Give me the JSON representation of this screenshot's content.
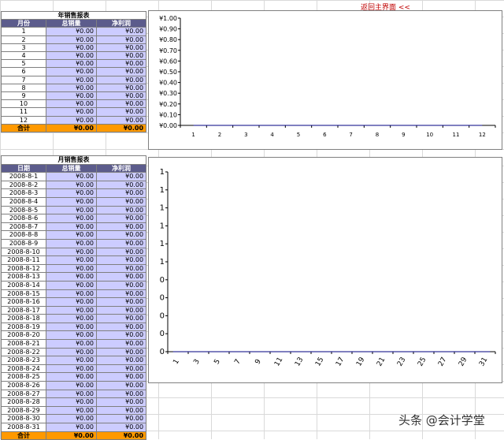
{
  "nav": {
    "return_link": "返回主界面 <<"
  },
  "year_report": {
    "title": "年销售报表",
    "headers": [
      "月份",
      "总销量",
      "净利润"
    ],
    "rows": [
      [
        "1",
        "¥0.00",
        "¥0.00"
      ],
      [
        "2",
        "¥0.00",
        "¥0.00"
      ],
      [
        "3",
        "¥0.00",
        "¥0.00"
      ],
      [
        "4",
        "¥0.00",
        "¥0.00"
      ],
      [
        "5",
        "¥0.00",
        "¥0.00"
      ],
      [
        "6",
        "¥0.00",
        "¥0.00"
      ],
      [
        "7",
        "¥0.00",
        "¥0.00"
      ],
      [
        "8",
        "¥0.00",
        "¥0.00"
      ],
      [
        "9",
        "¥0.00",
        "¥0.00"
      ],
      [
        "10",
        "¥0.00",
        "¥0.00"
      ],
      [
        "11",
        "¥0.00",
        "¥0.00"
      ],
      [
        "12",
        "¥0.00",
        "¥0.00"
      ]
    ],
    "total": [
      "合计",
      "¥0.00",
      "¥0.00"
    ]
  },
  "month_report": {
    "title": "月销售报表",
    "headers": [
      "日期",
      "总销量",
      "净利润"
    ],
    "rows": [
      [
        "2008-8-1",
        "¥0.00",
        "¥0.00"
      ],
      [
        "2008-8-2",
        "¥0.00",
        "¥0.00"
      ],
      [
        "2008-8-3",
        "¥0.00",
        "¥0.00"
      ],
      [
        "2008-8-4",
        "¥0.00",
        "¥0.00"
      ],
      [
        "2008-8-5",
        "¥0.00",
        "¥0.00"
      ],
      [
        "2008-8-6",
        "¥0.00",
        "¥0.00"
      ],
      [
        "2008-8-7",
        "¥0.00",
        "¥0.00"
      ],
      [
        "2008-8-8",
        "¥0.00",
        "¥0.00"
      ],
      [
        "2008-8-9",
        "¥0.00",
        "¥0.00"
      ],
      [
        "2008-8-10",
        "¥0.00",
        "¥0.00"
      ],
      [
        "2008-8-11",
        "¥0.00",
        "¥0.00"
      ],
      [
        "2008-8-12",
        "¥0.00",
        "¥0.00"
      ],
      [
        "2008-8-13",
        "¥0.00",
        "¥0.00"
      ],
      [
        "2008-8-14",
        "¥0.00",
        "¥0.00"
      ],
      [
        "2008-8-15",
        "¥0.00",
        "¥0.00"
      ],
      [
        "2008-8-16",
        "¥0.00",
        "¥0.00"
      ],
      [
        "2008-8-17",
        "¥0.00",
        "¥0.00"
      ],
      [
        "2008-8-18",
        "¥0.00",
        "¥0.00"
      ],
      [
        "2008-8-19",
        "¥0.00",
        "¥0.00"
      ],
      [
        "2008-8-20",
        "¥0.00",
        "¥0.00"
      ],
      [
        "2008-8-21",
        "¥0.00",
        "¥0.00"
      ],
      [
        "2008-8-22",
        "¥0.00",
        "¥0.00"
      ],
      [
        "2008-8-23",
        "¥0.00",
        "¥0.00"
      ],
      [
        "2008-8-24",
        "¥0.00",
        "¥0.00"
      ],
      [
        "2008-8-25",
        "¥0.00",
        "¥0.00"
      ],
      [
        "2008-8-26",
        "¥0.00",
        "¥0.00"
      ],
      [
        "2008-8-27",
        "¥0.00",
        "¥0.00"
      ],
      [
        "2008-8-28",
        "¥0.00",
        "¥0.00"
      ],
      [
        "2008-8-29",
        "¥0.00",
        "¥0.00"
      ],
      [
        "2008-8-30",
        "¥0.00",
        "¥0.00"
      ],
      [
        "2008-8-31",
        "¥0.00",
        "¥0.00"
      ]
    ],
    "total": [
      "合计",
      "¥0.00",
      "¥0.00"
    ]
  },
  "chart_data": [
    {
      "type": "line",
      "x": [
        "1",
        "2",
        "3",
        "4",
        "5",
        "6",
        "7",
        "8",
        "9",
        "10",
        "11",
        "12"
      ],
      "y_ticks": [
        "¥0.00",
        "¥0.10",
        "¥0.20",
        "¥0.30",
        "¥0.40",
        "¥0.50",
        "¥0.60",
        "¥0.70",
        "¥0.80",
        "¥0.90",
        "¥1.00"
      ],
      "ylim": [
        0,
        1
      ],
      "values": [
        0,
        0,
        0,
        0,
        0,
        0,
        0,
        0,
        0,
        0,
        0,
        0
      ],
      "grid": false
    },
    {
      "type": "line",
      "x": [
        "1",
        "3",
        "5",
        "7",
        "9",
        "11",
        "13",
        "15",
        "17",
        "19",
        "21",
        "23",
        "25",
        "27",
        "29",
        "31"
      ],
      "y_ticks": [
        "0",
        "0",
        "0",
        "0",
        "0",
        "1",
        "1",
        "1",
        "1",
        "1",
        "1"
      ],
      "ylim": [
        0,
        1
      ],
      "values": [
        0,
        0,
        0,
        0,
        0,
        0,
        0,
        0,
        0,
        0,
        0,
        0,
        0,
        0,
        0,
        0,
        0,
        0,
        0,
        0,
        0,
        0,
        0,
        0,
        0,
        0,
        0,
        0,
        0,
        0,
        0
      ],
      "grid": false
    }
  ],
  "watermark": "头条 @会计学堂"
}
